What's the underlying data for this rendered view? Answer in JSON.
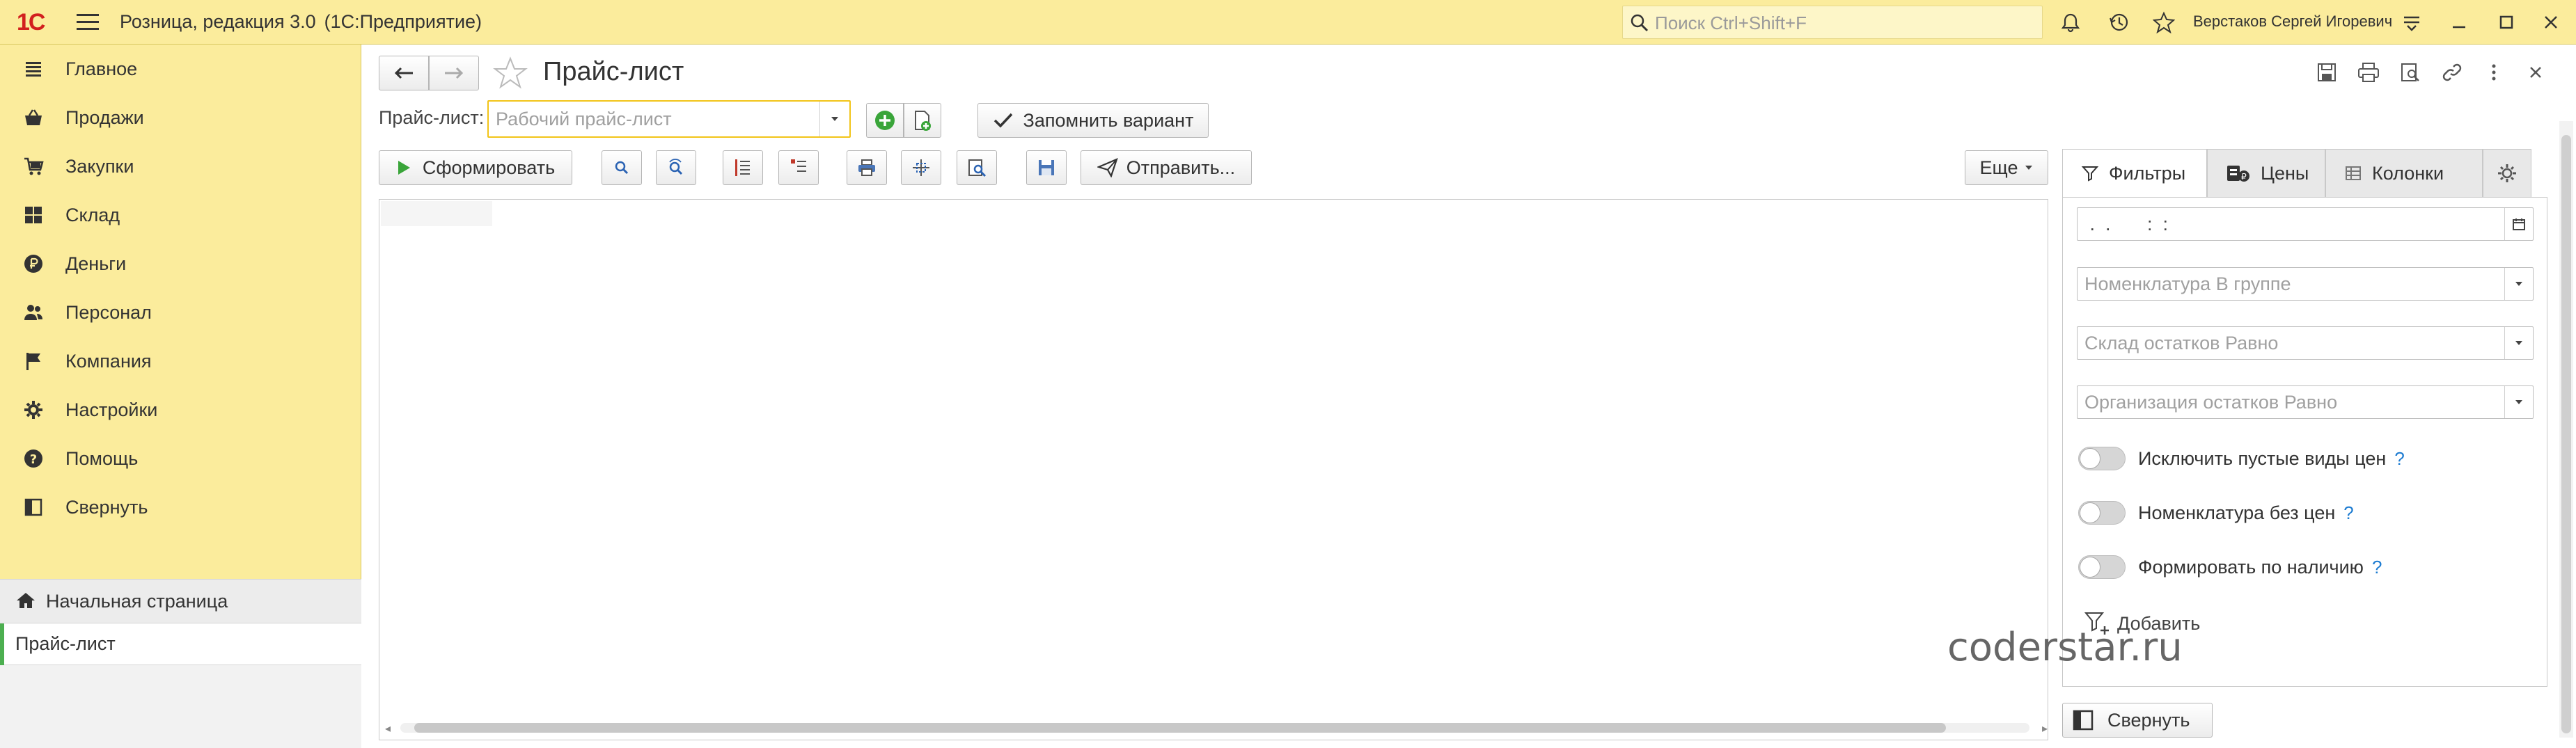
{
  "app": {
    "logo_text": "1С",
    "title": "Розница, редакция 3.0",
    "platform": "(1С:Предприятие)",
    "search_placeholder": "Поиск Ctrl+Shift+F",
    "user_name": "Верстаков Сергей Игоревич"
  },
  "sidebar": {
    "items": [
      {
        "label": "Главное",
        "icon": "list-icon"
      },
      {
        "label": "Продажи",
        "icon": "basket-icon"
      },
      {
        "label": "Закупки",
        "icon": "cart-icon"
      },
      {
        "label": "Склад",
        "icon": "grid-icon"
      },
      {
        "label": "Деньги",
        "icon": "ruble-icon"
      },
      {
        "label": "Персонал",
        "icon": "people-icon"
      },
      {
        "label": "Компания",
        "icon": "flag-icon"
      },
      {
        "label": "Настройки",
        "icon": "gear-icon"
      },
      {
        "label": "Помощь",
        "icon": "help-icon"
      },
      {
        "label": "Свернуть",
        "icon": "collapse-icon"
      }
    ],
    "home_tab": "Начальная страница",
    "open_tab": "Прайс-лист"
  },
  "main": {
    "page_title": "Прайс-лист",
    "price_list_label": "Прайс-лист:",
    "price_list_placeholder": "Рабочий прайс-лист",
    "remember_variant": "Запомнить вариант",
    "generate": "Сформировать",
    "send": "Отправить...",
    "more": "Еще"
  },
  "panel": {
    "tabs": [
      "Фильтры",
      "Цены",
      "Колонки"
    ],
    "date_value": " .  .       :  :",
    "filters": [
      "Номенклатура В группе",
      "Склад остатков Равно",
      "Организация остатков Равно"
    ],
    "toggles": [
      {
        "label": "Исключить пустые виды цен",
        "hint": "?"
      },
      {
        "label": "Номенклатура без цен",
        "hint": "?"
      },
      {
        "label": "Формировать по наличию",
        "hint": "?"
      }
    ],
    "add_label": "Добавить",
    "collapse_label": "Свернуть"
  },
  "watermark": "coderstar.ru",
  "colors": {
    "accent_yellow": "#fbec9c",
    "focus": "#f2c418",
    "green": "#4caf50",
    "hint_blue": "#1c7bd1"
  }
}
